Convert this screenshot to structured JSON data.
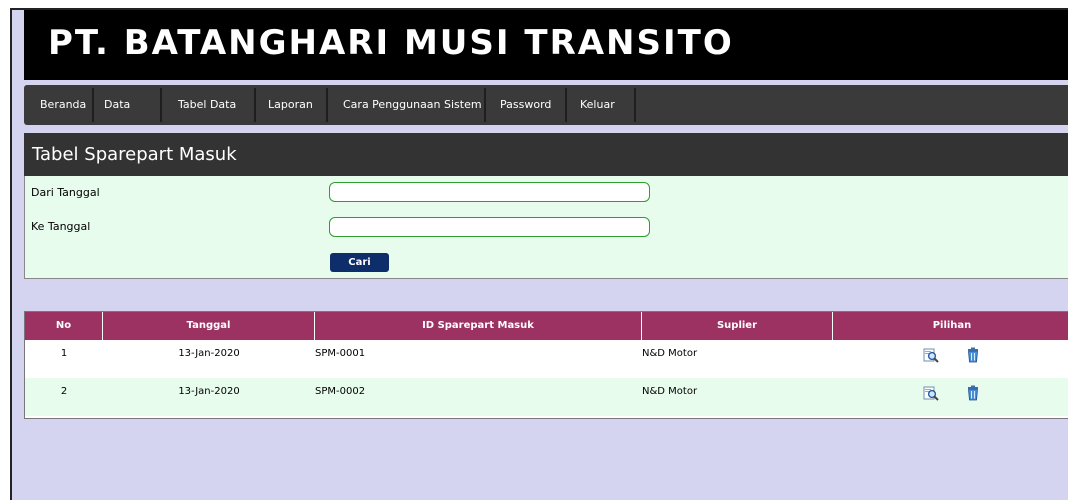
{
  "header": {
    "title": "PT. BATANGHARI MUSI TRANSITO"
  },
  "nav": {
    "items": [
      {
        "label": "Beranda"
      },
      {
        "label": "Data"
      },
      {
        "label": "Tabel Data"
      },
      {
        "label": "Laporan"
      },
      {
        "label": "Cara Penggunaan Sistem"
      },
      {
        "label": "Password"
      },
      {
        "label": "Keluar"
      }
    ]
  },
  "panel": {
    "title": "Tabel Sparepart Masuk"
  },
  "form": {
    "from_label": "Dari Tanggal",
    "from_value": "",
    "to_label": "Ke Tanggal",
    "to_value": "",
    "search_label": "Cari"
  },
  "table": {
    "headers": [
      "No",
      "Tanggal",
      "ID Sparepart Masuk",
      "Suplier",
      "Pilihan"
    ],
    "rows": [
      {
        "no": "1",
        "tanggal": "13-Jan-2020",
        "id": "SPM-0001",
        "suplier": "N&D Motor"
      },
      {
        "no": "2",
        "tanggal": "13-Jan-2020",
        "id": "SPM-0002",
        "suplier": "N&D Motor"
      }
    ]
  },
  "icons": [
    "view-icon",
    "delete-icon"
  ]
}
